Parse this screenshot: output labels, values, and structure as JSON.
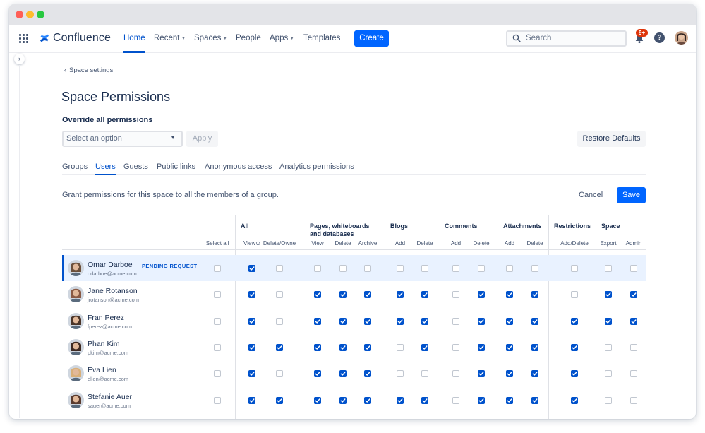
{
  "nav": {
    "logo_text": "Confluence",
    "items": [
      {
        "label": "Home",
        "active": true,
        "chevron": false
      },
      {
        "label": "Recent",
        "active": false,
        "chevron": true
      },
      {
        "label": "Spaces",
        "active": false,
        "chevron": true
      },
      {
        "label": "People",
        "active": false,
        "chevron": false
      },
      {
        "label": "Apps",
        "active": false,
        "chevron": true
      },
      {
        "label": "Templates",
        "active": false,
        "chevron": false
      }
    ],
    "create_label": "Create",
    "search_placeholder": "Search",
    "notification_badge": "9+",
    "help_symbol": "?",
    "icons": {
      "apps": "grid-icon",
      "logo": "confluence-logo-icon",
      "search": "search-icon",
      "notifications": "bell-icon",
      "help": "help-icon",
      "sidebar": "chevron-right-icon"
    },
    "colors": {
      "brand": "#0052cc",
      "create": "#0065ff",
      "badge": "#de350b"
    }
  },
  "page": {
    "back_label": "Space settings",
    "title": "Space Permissions",
    "override_label": "Override all permissions",
    "select_placeholder": "Select an option",
    "apply_label": "Apply",
    "restore_label": "Restore Defaults",
    "tabs": [
      "Groups",
      "Users",
      "Guests",
      "Public links",
      "Anonymous access",
      "Analytics permissions"
    ],
    "active_tab": "Users",
    "description": "Grant permissions for this space to all the members of a group.",
    "cancel_label": "Cancel",
    "save_label": "Save"
  },
  "table": {
    "groups": [
      "All",
      "Pages, whiteboards and databases",
      "Blogs",
      "Comments",
      "Attachments",
      "Restrictions",
      "Space"
    ],
    "columns": [
      "Select all",
      "View",
      "Delete/Owner",
      "View",
      "Delete",
      "Archive",
      "Add",
      "Delete",
      "Add",
      "Delete",
      "Add",
      "Delete",
      "Add/Delete",
      "Export",
      "Admin"
    ],
    "column_labels_display": [
      "Select all",
      "View⊙",
      "Delete/Owne",
      "View",
      "Delete",
      "Archive",
      "Add",
      "Delete",
      "Add",
      "Delete",
      "Add",
      "Delete",
      "Add/Delete",
      "Export",
      "Admin"
    ],
    "rows": [
      {
        "name": "Omar Darboe",
        "email": "odarboe@acme.com",
        "pending": "PENDING REQUEST",
        "highlighted": true,
        "perms": [
          false,
          true,
          false,
          false,
          false,
          false,
          false,
          false,
          false,
          false,
          false,
          false,
          false,
          false,
          false
        ]
      },
      {
        "name": "Jane Rotanson",
        "email": "jrotanson@acme.com",
        "pending": "",
        "highlighted": false,
        "perms": [
          false,
          true,
          false,
          true,
          true,
          true,
          true,
          true,
          false,
          true,
          true,
          true,
          false,
          true,
          true
        ]
      },
      {
        "name": "Fran Perez",
        "email": "fperez@acme.com",
        "pending": "",
        "highlighted": false,
        "perms": [
          false,
          true,
          false,
          true,
          true,
          true,
          true,
          true,
          false,
          true,
          true,
          true,
          true,
          true,
          true
        ]
      },
      {
        "name": "Phan Kim",
        "email": "pkim@acme.com",
        "pending": "",
        "highlighted": false,
        "perms": [
          false,
          true,
          true,
          true,
          true,
          true,
          false,
          true,
          false,
          true,
          true,
          true,
          true,
          false,
          false
        ]
      },
      {
        "name": "Eva Lien",
        "email": "elien@acme.com",
        "pending": "",
        "highlighted": false,
        "perms": [
          false,
          true,
          false,
          true,
          true,
          true,
          false,
          false,
          false,
          true,
          true,
          true,
          true,
          false,
          false
        ]
      },
      {
        "name": "Stefanie Auer",
        "email": "sauer@acme.com",
        "pending": "",
        "highlighted": false,
        "perms": [
          false,
          true,
          true,
          true,
          true,
          true,
          true,
          true,
          false,
          true,
          true,
          true,
          true,
          false,
          false
        ]
      }
    ],
    "avatar_colors": [
      "#6b4f3a",
      "#8a5a44",
      "#4a3428",
      "#3e2a22",
      "#d9b07a",
      "#5a3b2e"
    ]
  }
}
